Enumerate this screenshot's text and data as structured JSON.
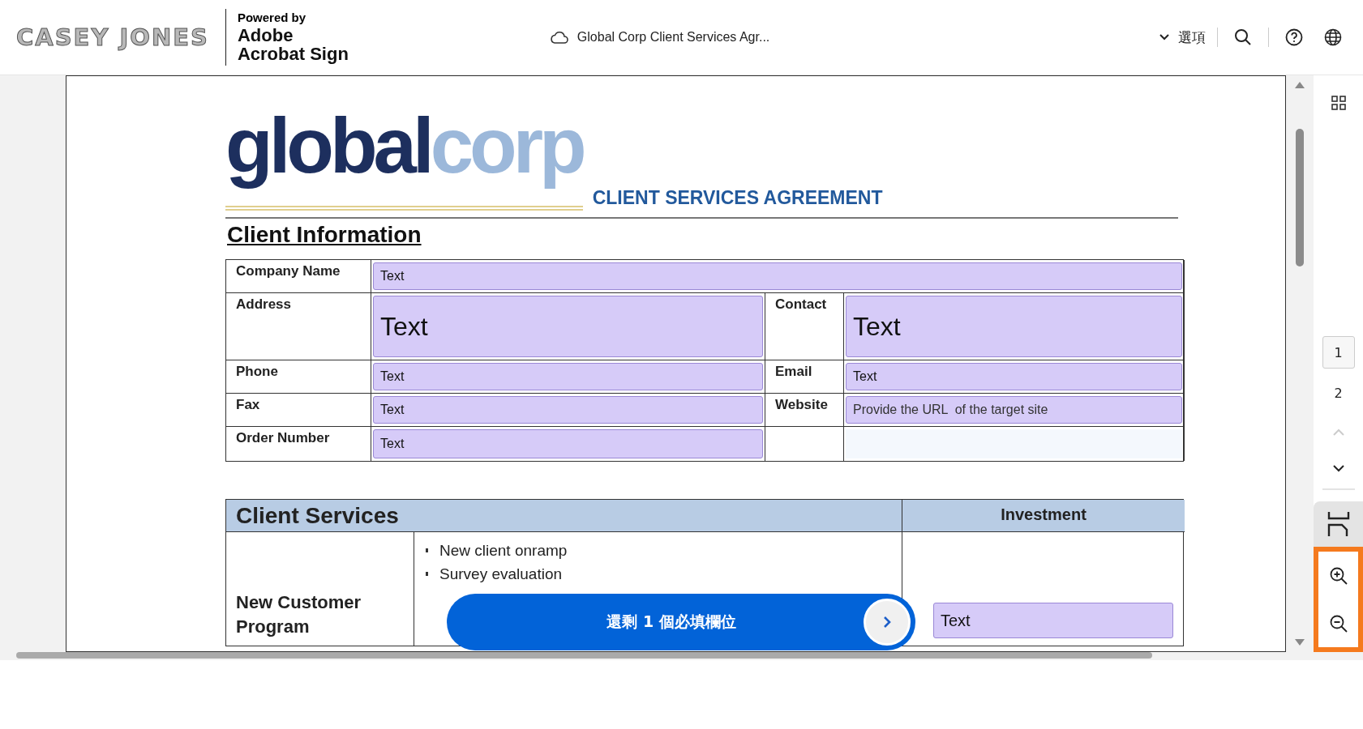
{
  "header": {
    "brand_logo": "CASEY JONES",
    "powered_by": "Powered by",
    "product_lines": [
      "Adobe",
      "Acrobat Sign"
    ],
    "document_title": "Global Corp Client Services Agr...",
    "options_label": "選項"
  },
  "document": {
    "logo": {
      "primary": "global",
      "secondary": "corp"
    },
    "title": "CLIENT SERVICES AGREEMENT",
    "section_heading": "Client Information",
    "client_info": [
      {
        "cells": [
          {
            "kind": "label",
            "text": "Company Name"
          },
          {
            "kind": "field-wide",
            "value": "Text"
          }
        ]
      },
      {
        "cells": [
          {
            "kind": "label",
            "text": "Address"
          },
          {
            "kind": "field-large",
            "value": "Text"
          },
          {
            "kind": "label",
            "text": "Contact"
          },
          {
            "kind": "field-large",
            "value": "Text"
          }
        ]
      },
      {
        "cells": [
          {
            "kind": "label",
            "text": "Phone"
          },
          {
            "kind": "field",
            "value": "Text"
          },
          {
            "kind": "label",
            "text": "Email"
          },
          {
            "kind": "field",
            "value": "Text"
          }
        ]
      },
      {
        "cells": [
          {
            "kind": "label",
            "text": "Fax"
          },
          {
            "kind": "field",
            "value": "Text"
          },
          {
            "kind": "label",
            "text": "Website"
          },
          {
            "kind": "field",
            "placeholder": "Provide the URL  of the target site"
          }
        ]
      },
      {
        "cells": [
          {
            "kind": "label",
            "text": "Order Number"
          },
          {
            "kind": "field",
            "value": "Text"
          },
          {
            "kind": "blank"
          },
          {
            "kind": "empty-field"
          }
        ]
      }
    ],
    "services": {
      "heading": "Client Services",
      "investment_heading": "Investment",
      "program": "New Customer Program",
      "items": [
        "New client onramp",
        "Survey evaluation"
      ],
      "investment_field": {
        "value": "Text"
      }
    }
  },
  "required_banner": {
    "text": "還剩 1 個必填欄位"
  },
  "rail": {
    "pages": [
      {
        "label": "1",
        "selected": true
      },
      {
        "label": "2",
        "selected": false
      }
    ],
    "previous_disabled": true,
    "next_disabled": false
  }
}
